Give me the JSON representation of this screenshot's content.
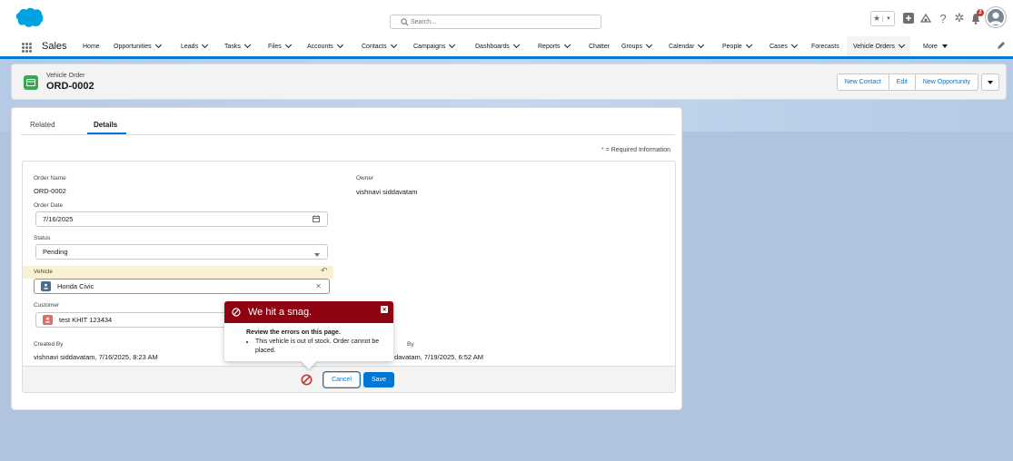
{
  "header": {
    "search_placeholder": "Search...",
    "notification_count": "2",
    "icons": [
      "salesforce-cloud-logo",
      "search-icon",
      "star-icon",
      "chevron-down-icon",
      "plus-icon",
      "trailhead-icon",
      "help-icon",
      "gear-icon",
      "bell-icon",
      "avatar"
    ]
  },
  "nav": {
    "app_name": "Sales",
    "items": [
      {
        "label": "Home"
      },
      {
        "label": "Opportunities"
      },
      {
        "label": "Leads"
      },
      {
        "label": "Tasks"
      },
      {
        "label": "Files"
      },
      {
        "label": "Accounts"
      },
      {
        "label": "Contacts"
      },
      {
        "label": "Campaigns"
      },
      {
        "label": "Dashboards"
      },
      {
        "label": "Reports"
      },
      {
        "label": "Chatter"
      },
      {
        "label": "Groups"
      },
      {
        "label": "Calendar"
      },
      {
        "label": "People"
      },
      {
        "label": "Cases"
      },
      {
        "label": "Forecasts"
      },
      {
        "label": "Vehicle Orders"
      },
      {
        "label": "More"
      }
    ]
  },
  "record": {
    "object_type": "Vehicle Order",
    "name": "ORD-0002",
    "actions": {
      "new_contact": "New Contact",
      "edit": "Edit",
      "new_opportunity": "New Opportunity"
    }
  },
  "tabs": {
    "related": "Related",
    "details": "Details"
  },
  "required_info": {
    "star": "*",
    "text": " = Required Information"
  },
  "form": {
    "order_name_label": "Order Name",
    "order_name_value": "ORD-0002",
    "owner_label": "Owner",
    "owner_value": "vishnavi siddavatam",
    "order_date_label": "Order Date",
    "order_date_value": "7/16/2025",
    "status_label": "Status",
    "status_value": "Pending",
    "vehicle_label": "Vehicle",
    "vehicle_value": "Honda Civic",
    "customer_label": "Customer",
    "customer_value": "test KHIT 123434",
    "created_by_label": "Created By",
    "created_by_value": "vishnavi siddavatam, 7/16/2025, 8:23 AM",
    "modified_by_label": "By",
    "modified_by_value": "davatam, 7/19/2025, 6:52 AM"
  },
  "footer": {
    "cancel": "Cancel",
    "save": "Save"
  },
  "error": {
    "title": "We hit a snag.",
    "subtitle": "Review the errors on this page.",
    "message": "This vehicle is out of stock. Order cannot be placed."
  },
  "colors": {
    "brand": "#0176d3",
    "error": "#8e030f",
    "record_icon": "#3ba755"
  }
}
